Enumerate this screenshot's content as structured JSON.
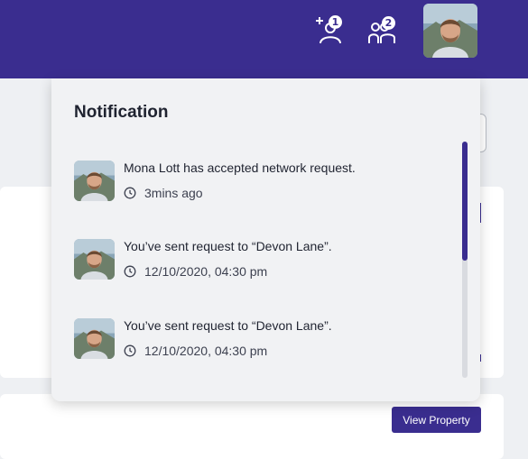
{
  "header": {
    "icons": [
      {
        "name": "add-user-icon",
        "badge": "1"
      },
      {
        "name": "users-group-icon",
        "badge": "2"
      }
    ],
    "avatar": "user-avatar"
  },
  "notifications": {
    "title": "Notification",
    "items": [
      {
        "message": "Mona Lott has accepted network request.",
        "time": "3mins ago"
      },
      {
        "message": "You’ve sent request to “Devon Lane”.",
        "time": "12/10/2020, 04:30 pm"
      },
      {
        "message": "You’ve sent request to “Devon Lane”.",
        "time": "12/10/2020, 04:30 pm"
      }
    ]
  },
  "page": {
    "view_property_label": "View Property"
  },
  "colors": {
    "primary": "#3a2d8f",
    "panel": "#f1f2f4",
    "page_bg": "#eef0f3"
  }
}
